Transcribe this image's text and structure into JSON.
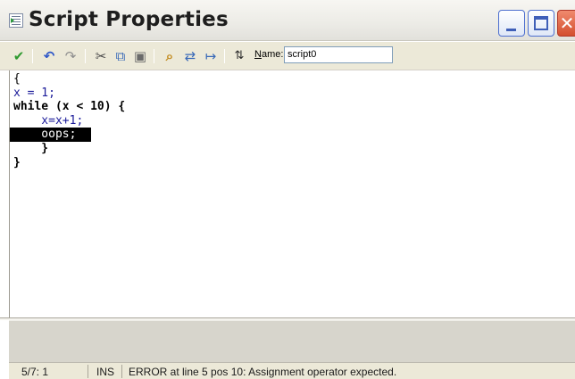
{
  "window": {
    "title": "Script Properties",
    "close_glyph": "✕"
  },
  "toolbar": {
    "icons": {
      "accept": "✔",
      "undo": "↶",
      "redo": "↷",
      "cut": "✂",
      "copy": "⧉",
      "paste": "▣",
      "find": "⌕",
      "replace": "⇄",
      "goto": "↦",
      "sort": "⇅"
    },
    "name_label": "Name:",
    "name_value": "script0"
  },
  "editor": {
    "lines": [
      "{",
      "x = 1;",
      "while (x < 10) {",
      "    x=x+1;",
      "    oops;",
      "    }",
      "}"
    ],
    "highlighted_line": 5
  },
  "statusbar": {
    "position": "5/7:  1",
    "mode": "INS",
    "message": "ERROR at line 5 pos 10: Assignment operator expected."
  },
  "colors": {
    "keyword": "#000000",
    "identifier": "#1d1d9b",
    "highlight_bg": "#000000",
    "highlight_fg": "#ffffff",
    "toolbar_bg": "#ece9d8"
  }
}
